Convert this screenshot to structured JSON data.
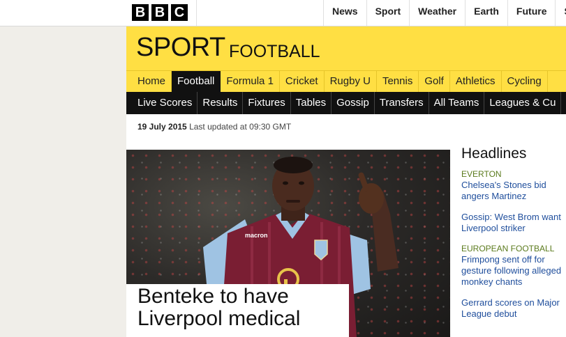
{
  "masthead": {
    "logo_letters": [
      "B",
      "B",
      "C"
    ],
    "nav": [
      "News",
      "Sport",
      "Weather",
      "Earth",
      "Future",
      "Sho"
    ]
  },
  "header": {
    "title": "SPORT",
    "section": "FOOTBALL"
  },
  "sport_nav": {
    "items": [
      "Home",
      "Football",
      "Formula 1",
      "Cricket",
      "Rugby U",
      "Tennis",
      "Golf",
      "Athletics",
      "Cycling"
    ],
    "active": "Football"
  },
  "sub_nav": {
    "items": [
      "Live Scores",
      "Results",
      "Fixtures",
      "Tables",
      "Gossip",
      "Transfers",
      "All Teams",
      "Leagues & Cu"
    ]
  },
  "dateline": {
    "date": "19 July 2015",
    "updated": "Last updated at 09:30 GMT"
  },
  "hero": {
    "headline": "Benteke to have Liverpool medical",
    "shirt_sponsor": "macron"
  },
  "headlines": {
    "title": "Headlines",
    "items": [
      {
        "tag": "EVERTON",
        "text": "Chelsea's Stones bid angers Martinez"
      },
      {
        "tag": "",
        "text": "Gossip: West Brom want Liverpool striker"
      },
      {
        "tag": "EUROPEAN FOOTBALL",
        "text": "Frimpong sent off for gesture following alleged monkey chants"
      },
      {
        "tag": "",
        "text": "Gerrard scores on Major League debut"
      }
    ]
  },
  "colors": {
    "sport_yellow": "#ffdf43",
    "nav_black": "#111111",
    "link_blue": "#1f4e9c",
    "tag_green": "#5a7a1c",
    "claret": "#7a1e33",
    "sky_blue": "#9fc3e3"
  }
}
